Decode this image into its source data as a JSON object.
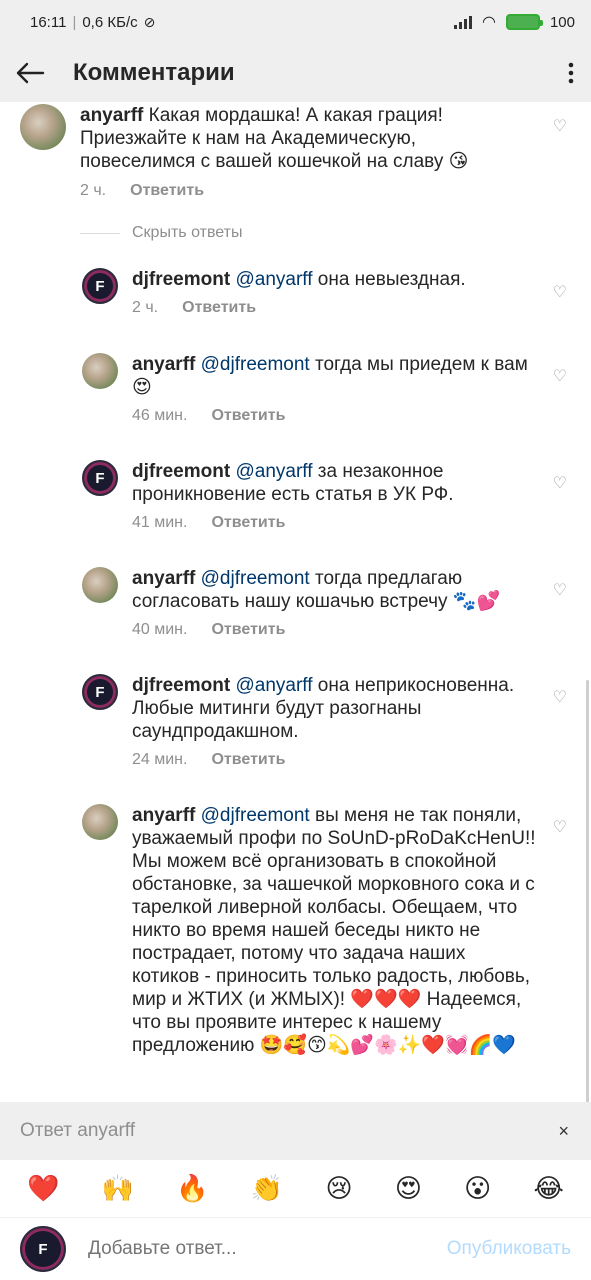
{
  "status": {
    "time": "16:11",
    "speed": "0,6 КБ/с",
    "battery": "100"
  },
  "appbar": {
    "title": "Комментарии"
  },
  "hide_replies": "Скрыть ответы",
  "reply_label": "Ответить",
  "comments": [
    {
      "user": "anyarff",
      "mention": "",
      "text": " Какая мордашка! А какая грация! Приезжайте к нам на Академическую, повеселимся с вашей кошечкой на славу 😘",
      "time": "2 ч."
    },
    {
      "user": "djfreemont",
      "mention": " @anyarff",
      "text": " она невыездная.",
      "time": "2 ч."
    },
    {
      "user": "anyarff",
      "mention": " @djfreemont",
      "text": " тогда мы приедем к вам 😍",
      "time": "46 мин."
    },
    {
      "user": "djfreemont",
      "mention": " @anyarff",
      "text": " за незаконное проникновение есть статья в УК РФ.",
      "time": "41 мин."
    },
    {
      "user": "anyarff",
      "mention": " @djfreemont",
      "text": " тогда предлагаю согласовать нашу кошачью встречу 🐾💕",
      "time": "40 мин."
    },
    {
      "user": "djfreemont",
      "mention": " @anyarff",
      "text": " она неприкосновенна. Любые митинги будут разогнаны саундпродакшном.",
      "time": "24 мин."
    },
    {
      "user": "anyarff",
      "mention": " @djfreemont",
      "text": " вы меня не так поняли, уважаемый профи по SoUnD-pRoDaKcHenU!! Мы можем всё организовать в спокойной обстановке, за чашечкой морковного сока и с тарелкой ливерной колбасы. Обещаем, что никто во время нашей беседы никто не пострадает, потому что задача наших котиков - приносить только радость, любовь, мир и ЖТИХ (и ЖМЫХ)! ❤️❤️❤️ Надеемся, что вы проявите интерес к нашему предложению 🤩🥰😙💫💕🌸✨❤️💓🌈💙",
      "time": ""
    }
  ],
  "reply_banner": {
    "label": "Ответ anyarff",
    "close": "×"
  },
  "emojis": [
    "❤️",
    "🙌",
    "🔥",
    "👏",
    "😢",
    "😍",
    "😮",
    "😂"
  ],
  "composer": {
    "placeholder": "Добавьте ответ...",
    "post": "Опубликовать",
    "avatar_letter": "F"
  }
}
